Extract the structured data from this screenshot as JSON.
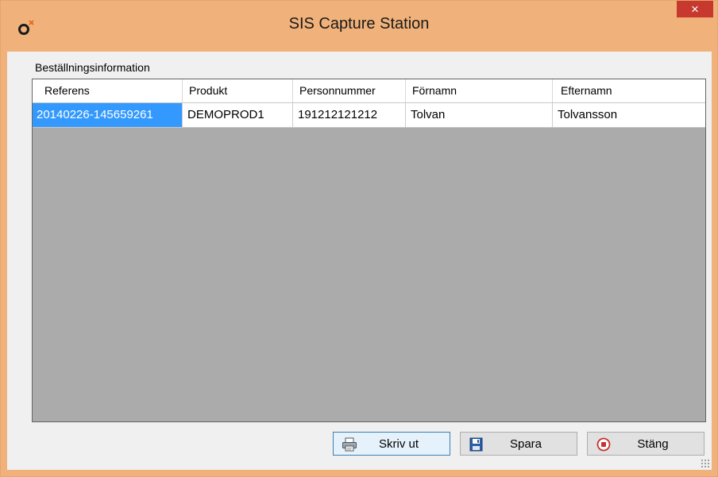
{
  "window": {
    "title": "SIS Capture Station",
    "close_label": "×"
  },
  "group": {
    "label": "Beställningsinformation"
  },
  "table": {
    "columns": [
      "Referens",
      "Produkt",
      "Personnummer",
      "Förnamn",
      "Efternamn"
    ],
    "rows": [
      [
        "20140226-145659261",
        "DEMOPROD1",
        "191212121212",
        "Tolvan",
        "Tolvansson"
      ]
    ]
  },
  "buttons": {
    "print": "Skriv ut",
    "save": "Spara",
    "close": "Stäng"
  },
  "colors": {
    "titlebar": "#f0b27a",
    "close": "#c7392f",
    "selection": "#3399ff",
    "grid_background": "#ababab"
  },
  "icons": {
    "app": "sis-logo-icon",
    "print": "printer-icon",
    "save": "floppy-disk-icon",
    "close": "stop-circle-icon"
  }
}
